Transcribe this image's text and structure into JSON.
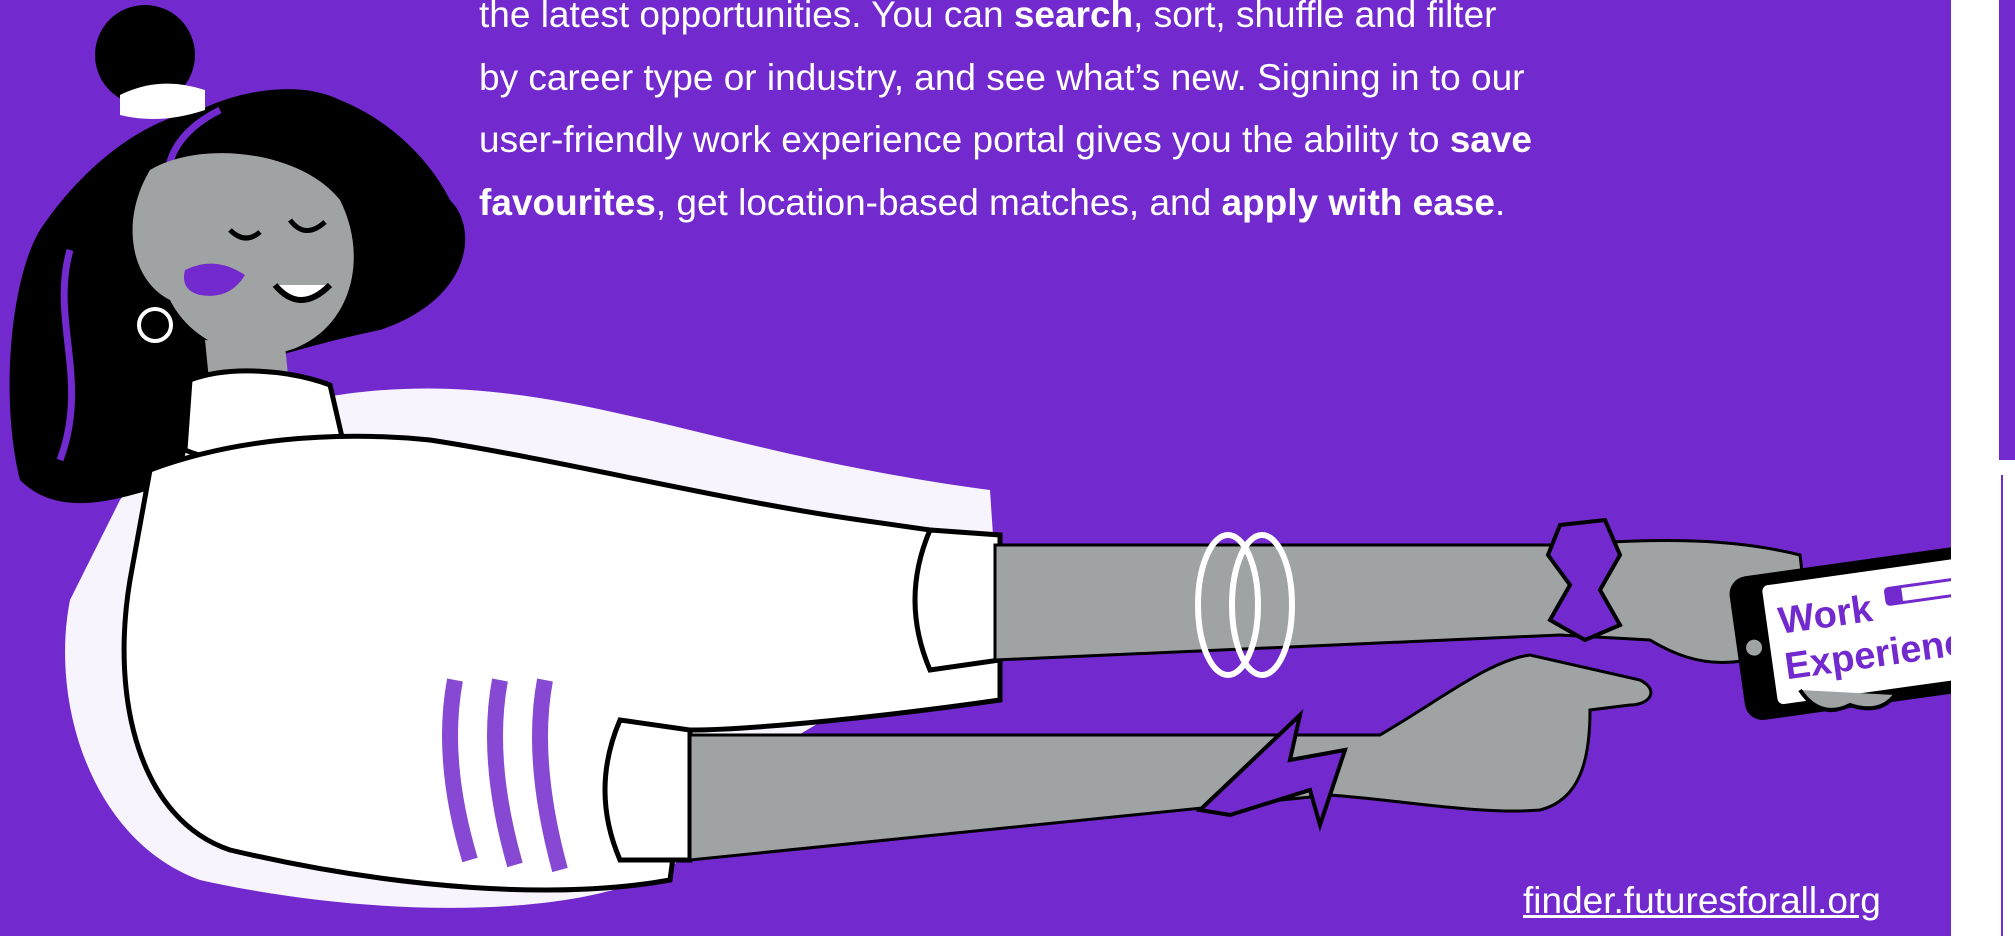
{
  "body": {
    "line1_pre": "the latest opportunities. You can ",
    "line1_b": "search",
    "line1_post": ", sort, shuffle and filter",
    "line2": "by career type or industry, and see what’s new. Signing in to our",
    "line3_pre": "user-friendly work experience portal gives you the ability to ",
    "line3_b": "save",
    "line4_b1": "favourites",
    "line4_mid": ", get location-based matches, and ",
    "line4_b2": "apply with ease",
    "line4_end": "."
  },
  "link": {
    "text": "finder.futuresforall.org"
  },
  "phone": {
    "line1": "Work",
    "line2": "Experience"
  },
  "colors": {
    "brand_purple": "#7229cd",
    "skin_grey": "#a0a3a4",
    "white": "#ffffff",
    "ink": "#000000"
  },
  "illustration": {
    "name": "woman-pointing-at-phone-illustration"
  }
}
